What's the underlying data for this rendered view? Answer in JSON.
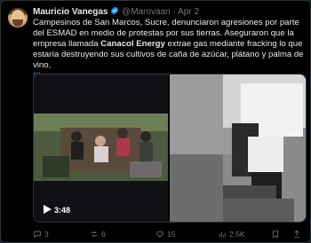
{
  "author": {
    "name": "Mauricio Vanegas",
    "handle": "@Marovaan",
    "separator": "·",
    "date": "Apr 2"
  },
  "text": {
    "line1": "Campesinos de San Marcos, Sucre, denunciaron agresiones por parte del ESMAD en medio de protestas por sus tierras. Aseguraron que la empresa llamada ",
    "bold": "Canacol Energy",
    "line2": " extrae gas mediante fracking lo que estaría destruyendo sus cultivos de caña de azúcar, plátano y palma de vino,",
    "show_more": "Show more"
  },
  "media": {
    "duration": "3:48"
  },
  "actions": {
    "replies": "3",
    "reposts": "6",
    "likes": "15",
    "views": "2.5K"
  },
  "colors": {
    "accent": "#1d9bf0",
    "muted": "#71767b"
  },
  "icons": [
    "verified-badge-icon",
    "play-icon",
    "reply-icon",
    "repost-icon",
    "like-icon",
    "views-icon",
    "bookmark-icon",
    "share-icon"
  ]
}
